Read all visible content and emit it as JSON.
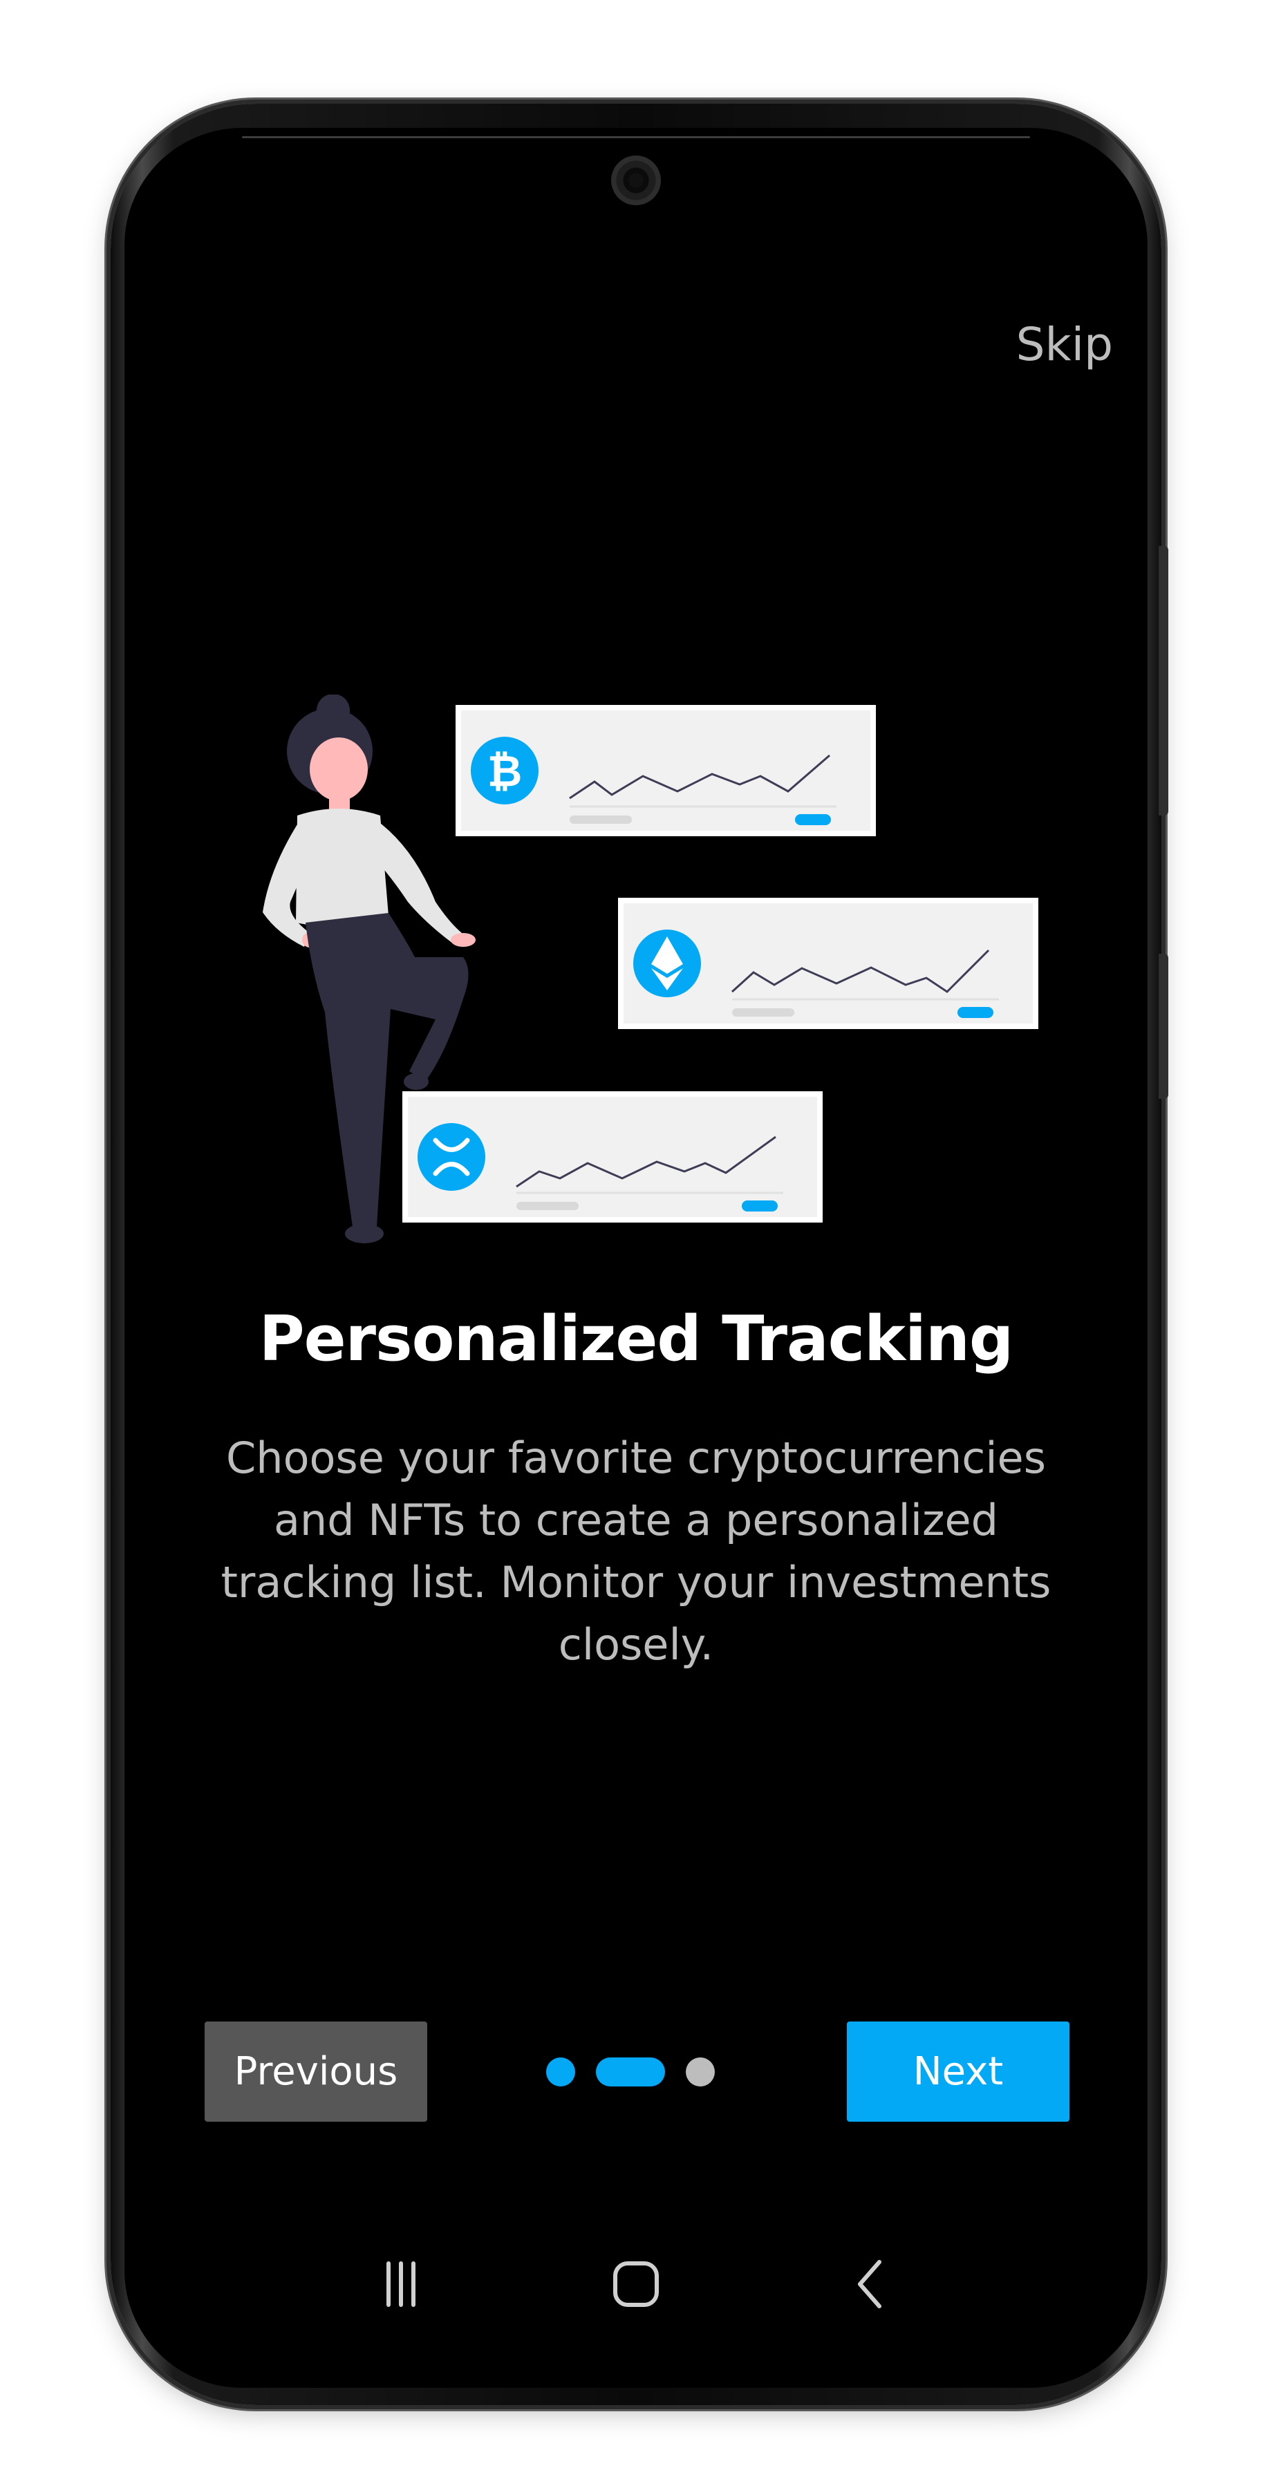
{
  "onboarding": {
    "skip_label": "Skip",
    "title": "Personalized Tracking",
    "description": "Choose your favorite cryptocurrencies and NFTs to create a personalized tracking list. Monitor your investments closely.",
    "previous_label": "Previous",
    "next_label": "Next",
    "page_indicator": {
      "total": 3,
      "active_index": 1
    }
  },
  "illustration": {
    "cards": [
      {
        "coin_icon": "bitcoin-icon",
        "symbol": "₿"
      },
      {
        "coin_icon": "ethereum-icon",
        "symbol": ""
      },
      {
        "coin_icon": "xrp-icon",
        "symbol": ""
      }
    ]
  },
  "navbar": {
    "icons": [
      "recent-apps-icon",
      "home-icon",
      "back-icon"
    ]
  },
  "colors": {
    "accent": "#03a9f4",
    "background": "#000000",
    "secondary_button": "#575757",
    "muted_text": "#bdbdbd",
    "title_text": "#ffffff"
  }
}
